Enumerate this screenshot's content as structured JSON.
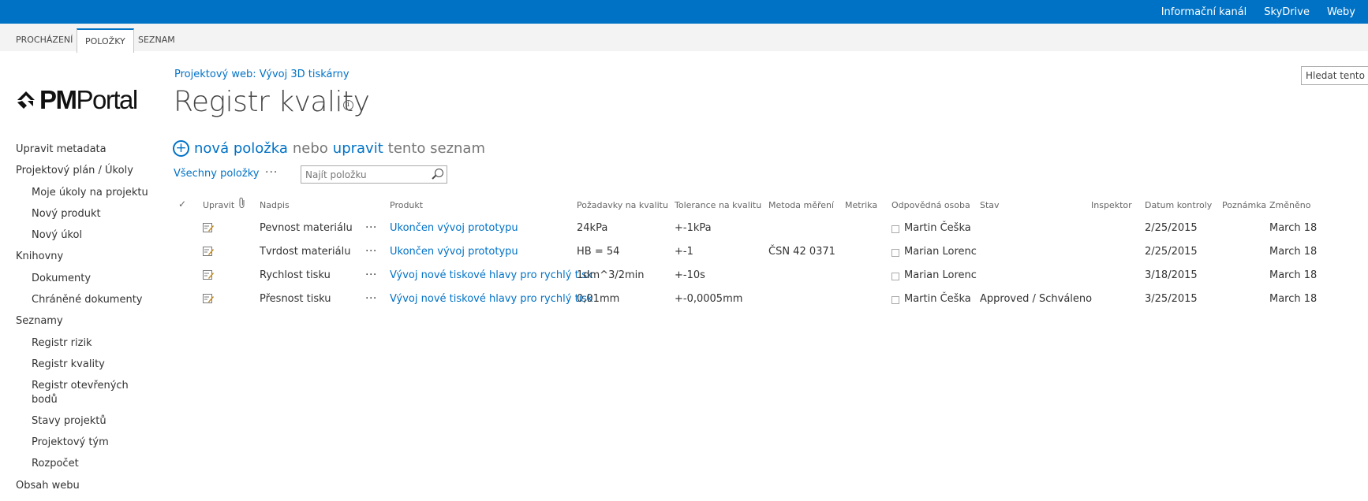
{
  "top_links": [
    "Informační kanál",
    "SkyDrive",
    "Weby"
  ],
  "ribbon_tabs": [
    "PROCHÁZENÍ",
    "POLOŽKY",
    "SEZNAM"
  ],
  "logo": {
    "prefix": "PM",
    "suffix": "Portal"
  },
  "nav": [
    {
      "label": "Upravit metadata",
      "level": 0
    },
    {
      "label": "Projektový plán / Úkoly",
      "level": 0
    },
    {
      "label": "Moje úkoly na projektu",
      "level": 1
    },
    {
      "label": "Nový produkt",
      "level": 1
    },
    {
      "label": "Nový úkol",
      "level": 1
    },
    {
      "label": "Knihovny",
      "level": 0
    },
    {
      "label": "Dokumenty",
      "level": 1
    },
    {
      "label": "Chráněné dokumenty",
      "level": 1
    },
    {
      "label": "Seznamy",
      "level": 0
    },
    {
      "label": "Registr rizik",
      "level": 1
    },
    {
      "label": "Registr kvality",
      "level": 1
    },
    {
      "label": "Registr otevřených",
      "level": 1
    },
    {
      "label": "bodů",
      "level": 1
    },
    {
      "label": "Stavy projektů",
      "level": 1
    },
    {
      "label": "Projektový tým",
      "level": 1
    },
    {
      "label": "Rozpočet",
      "level": 1
    },
    {
      "label": "Obsah webu",
      "level": 0
    }
  ],
  "breadcrumb": "Projektový web: Vývoj 3D tiskárny",
  "page_title": "Registr kvality",
  "info_glyph": "i",
  "new_item": {
    "link": "nová položka",
    "or": "nebo",
    "edit": "upravit",
    "rest": "tento seznam"
  },
  "views": {
    "all": "Všechny položky",
    "more": "···"
  },
  "find_placeholder": "Najít položku",
  "site_search_placeholder": "Hledat tento web",
  "columns": [
    "Upravit",
    "Nadpis",
    "Produkt",
    "Požadavky na kvalitu",
    "Tolerance na kvalitu",
    "Metoda měření",
    "Metrika",
    "Odpovědná osoba",
    "Stav",
    "Inspektor",
    "Datum kontroly",
    "Poznámka",
    "Změněno"
  ],
  "rows": [
    {
      "title": "Pevnost materiálu",
      "product": "Ukončen vývoj prototypu",
      "req": "24kPa",
      "tol": "+-1kPa",
      "method": "",
      "metric": "",
      "person": "Martin Češka",
      "status": "",
      "inspector": "",
      "date": "2/25/2015",
      "note": "",
      "changed": "March 18"
    },
    {
      "title": "Tvrdost materiálu",
      "product": "Ukončen vývoj prototypu",
      "req": "HB = 54",
      "tol": "+-1",
      "method": "ČSN 42 0371",
      "metric": "",
      "person": "Marian Lorenc",
      "status": "",
      "inspector": "",
      "date": "2/25/2015",
      "note": "",
      "changed": "March 18"
    },
    {
      "title": "Rychlost tisku",
      "product": "Vývoj nové tiskové hlavy pro rychlý tisk",
      "req": "1dm^3/2min",
      "tol": "+-10s",
      "method": "",
      "metric": "",
      "person": "Marian Lorenc",
      "status": "",
      "inspector": "",
      "date": "3/18/2015",
      "note": "",
      "changed": "March 18"
    },
    {
      "title": "Přesnost tisku",
      "product": "Vývoj nové tiskové hlavy pro rychlý tisk",
      "req": "0,01mm",
      "tol": "+-0,0005mm",
      "method": "",
      "metric": "",
      "person": "Martin Češka",
      "status": "Approved / Schváleno",
      "inspector": "",
      "date": "3/25/2015",
      "note": "",
      "changed": "March 18"
    }
  ],
  "colors": {
    "brand": "#0072c6",
    "ribbon": "#f3f3f3",
    "text": "#444444"
  }
}
